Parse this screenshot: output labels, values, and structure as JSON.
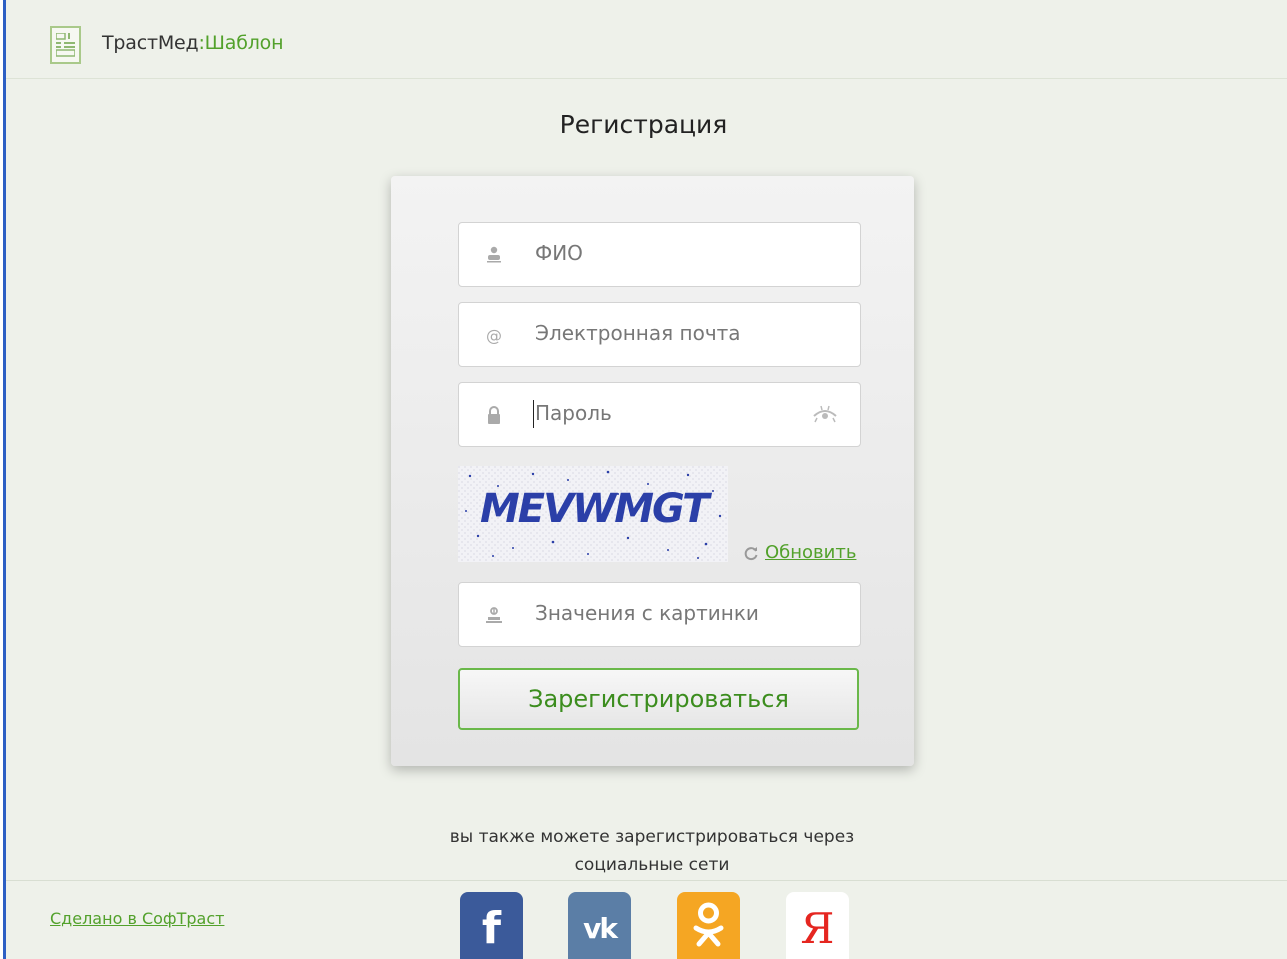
{
  "header": {
    "brand_part1": "ТрастМед",
    "brand_part2": ":Шаблон"
  },
  "form": {
    "title": "Регистрация",
    "fields": [
      {
        "placeholder": "ФИО",
        "icon": "user-icon"
      },
      {
        "placeholder": "Электронная почта",
        "icon": "at-icon"
      },
      {
        "placeholder": "Пароль",
        "icon": "lock-icon",
        "extra_icon": "eye-toggle-icon"
      }
    ],
    "captcha_text": "MEVWMGT",
    "refresh_label": "Обновить",
    "captcha_field": {
      "placeholder": "Значения с картинки",
      "icon": "captcha-icon"
    },
    "submit_label": "Зарегистрироваться"
  },
  "social": {
    "text_line1": "вы также можете зарегистрироваться через",
    "text_line2": "социальные сети",
    "networks": [
      {
        "name": "facebook",
        "glyph": "f",
        "color": "#3b5a9a"
      },
      {
        "name": "vkontakte",
        "glyph": "vk",
        "color": "#5b7ea6"
      },
      {
        "name": "odnoklassniki",
        "glyph": "ok",
        "color": "#f5a623"
      },
      {
        "name": "yandex",
        "glyph": "Я",
        "color": "#ffffff"
      }
    ]
  },
  "footer": {
    "made_in": "Сделано в СофТраст"
  },
  "colors": {
    "accent_green": "#52a12b",
    "background": "#eef1ea",
    "window_stripe": "#2d5fc4"
  }
}
